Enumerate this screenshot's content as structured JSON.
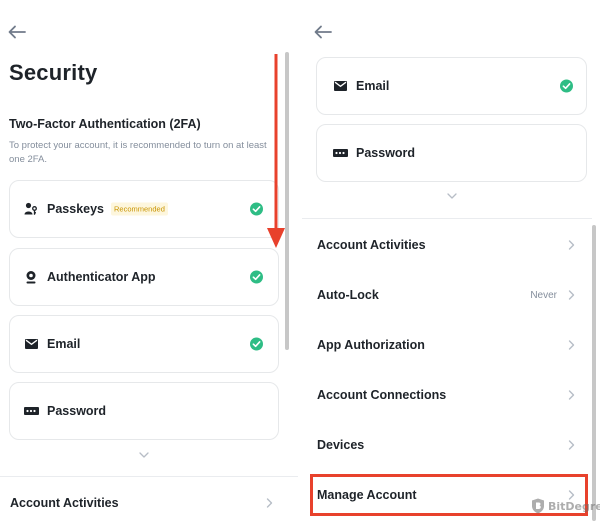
{
  "left": {
    "title": "Security",
    "section_title": "Two-Factor Authentication (2FA)",
    "section_desc": "To protect your account, it is recommended to turn on at least one 2FA.",
    "methods": [
      {
        "label": "Passkeys",
        "badge": "Recommended",
        "icon": "passkey-icon",
        "enabled": true
      },
      {
        "label": "Authenticator App",
        "icon": "authenticator-icon",
        "enabled": true
      },
      {
        "label": "Email",
        "icon": "envelope-icon",
        "enabled": true
      },
      {
        "label": "Password",
        "icon": "password-icon",
        "enabled": false
      }
    ],
    "rows": [
      {
        "label": "Account Activities"
      }
    ]
  },
  "right": {
    "methods": [
      {
        "label": "Email",
        "icon": "envelope-icon",
        "enabled": true
      },
      {
        "label": "Password",
        "icon": "password-icon",
        "enabled": false
      }
    ],
    "rows": [
      {
        "label": "Account Activities",
        "value": ""
      },
      {
        "label": "Auto-Lock",
        "value": "Never"
      },
      {
        "label": "App Authorization",
        "value": ""
      },
      {
        "label": "Account Connections",
        "value": ""
      },
      {
        "label": "Devices",
        "value": ""
      },
      {
        "label": "Manage Account",
        "value": ""
      }
    ]
  },
  "watermark": {
    "text": "BitDegree"
  },
  "colors": {
    "text": "#1e2329",
    "muted": "#848e9c",
    "check": "#2ebd85",
    "badge_text": "#c99400",
    "badge_bg": "#fdf6dd",
    "annotation": "#e8412c"
  }
}
